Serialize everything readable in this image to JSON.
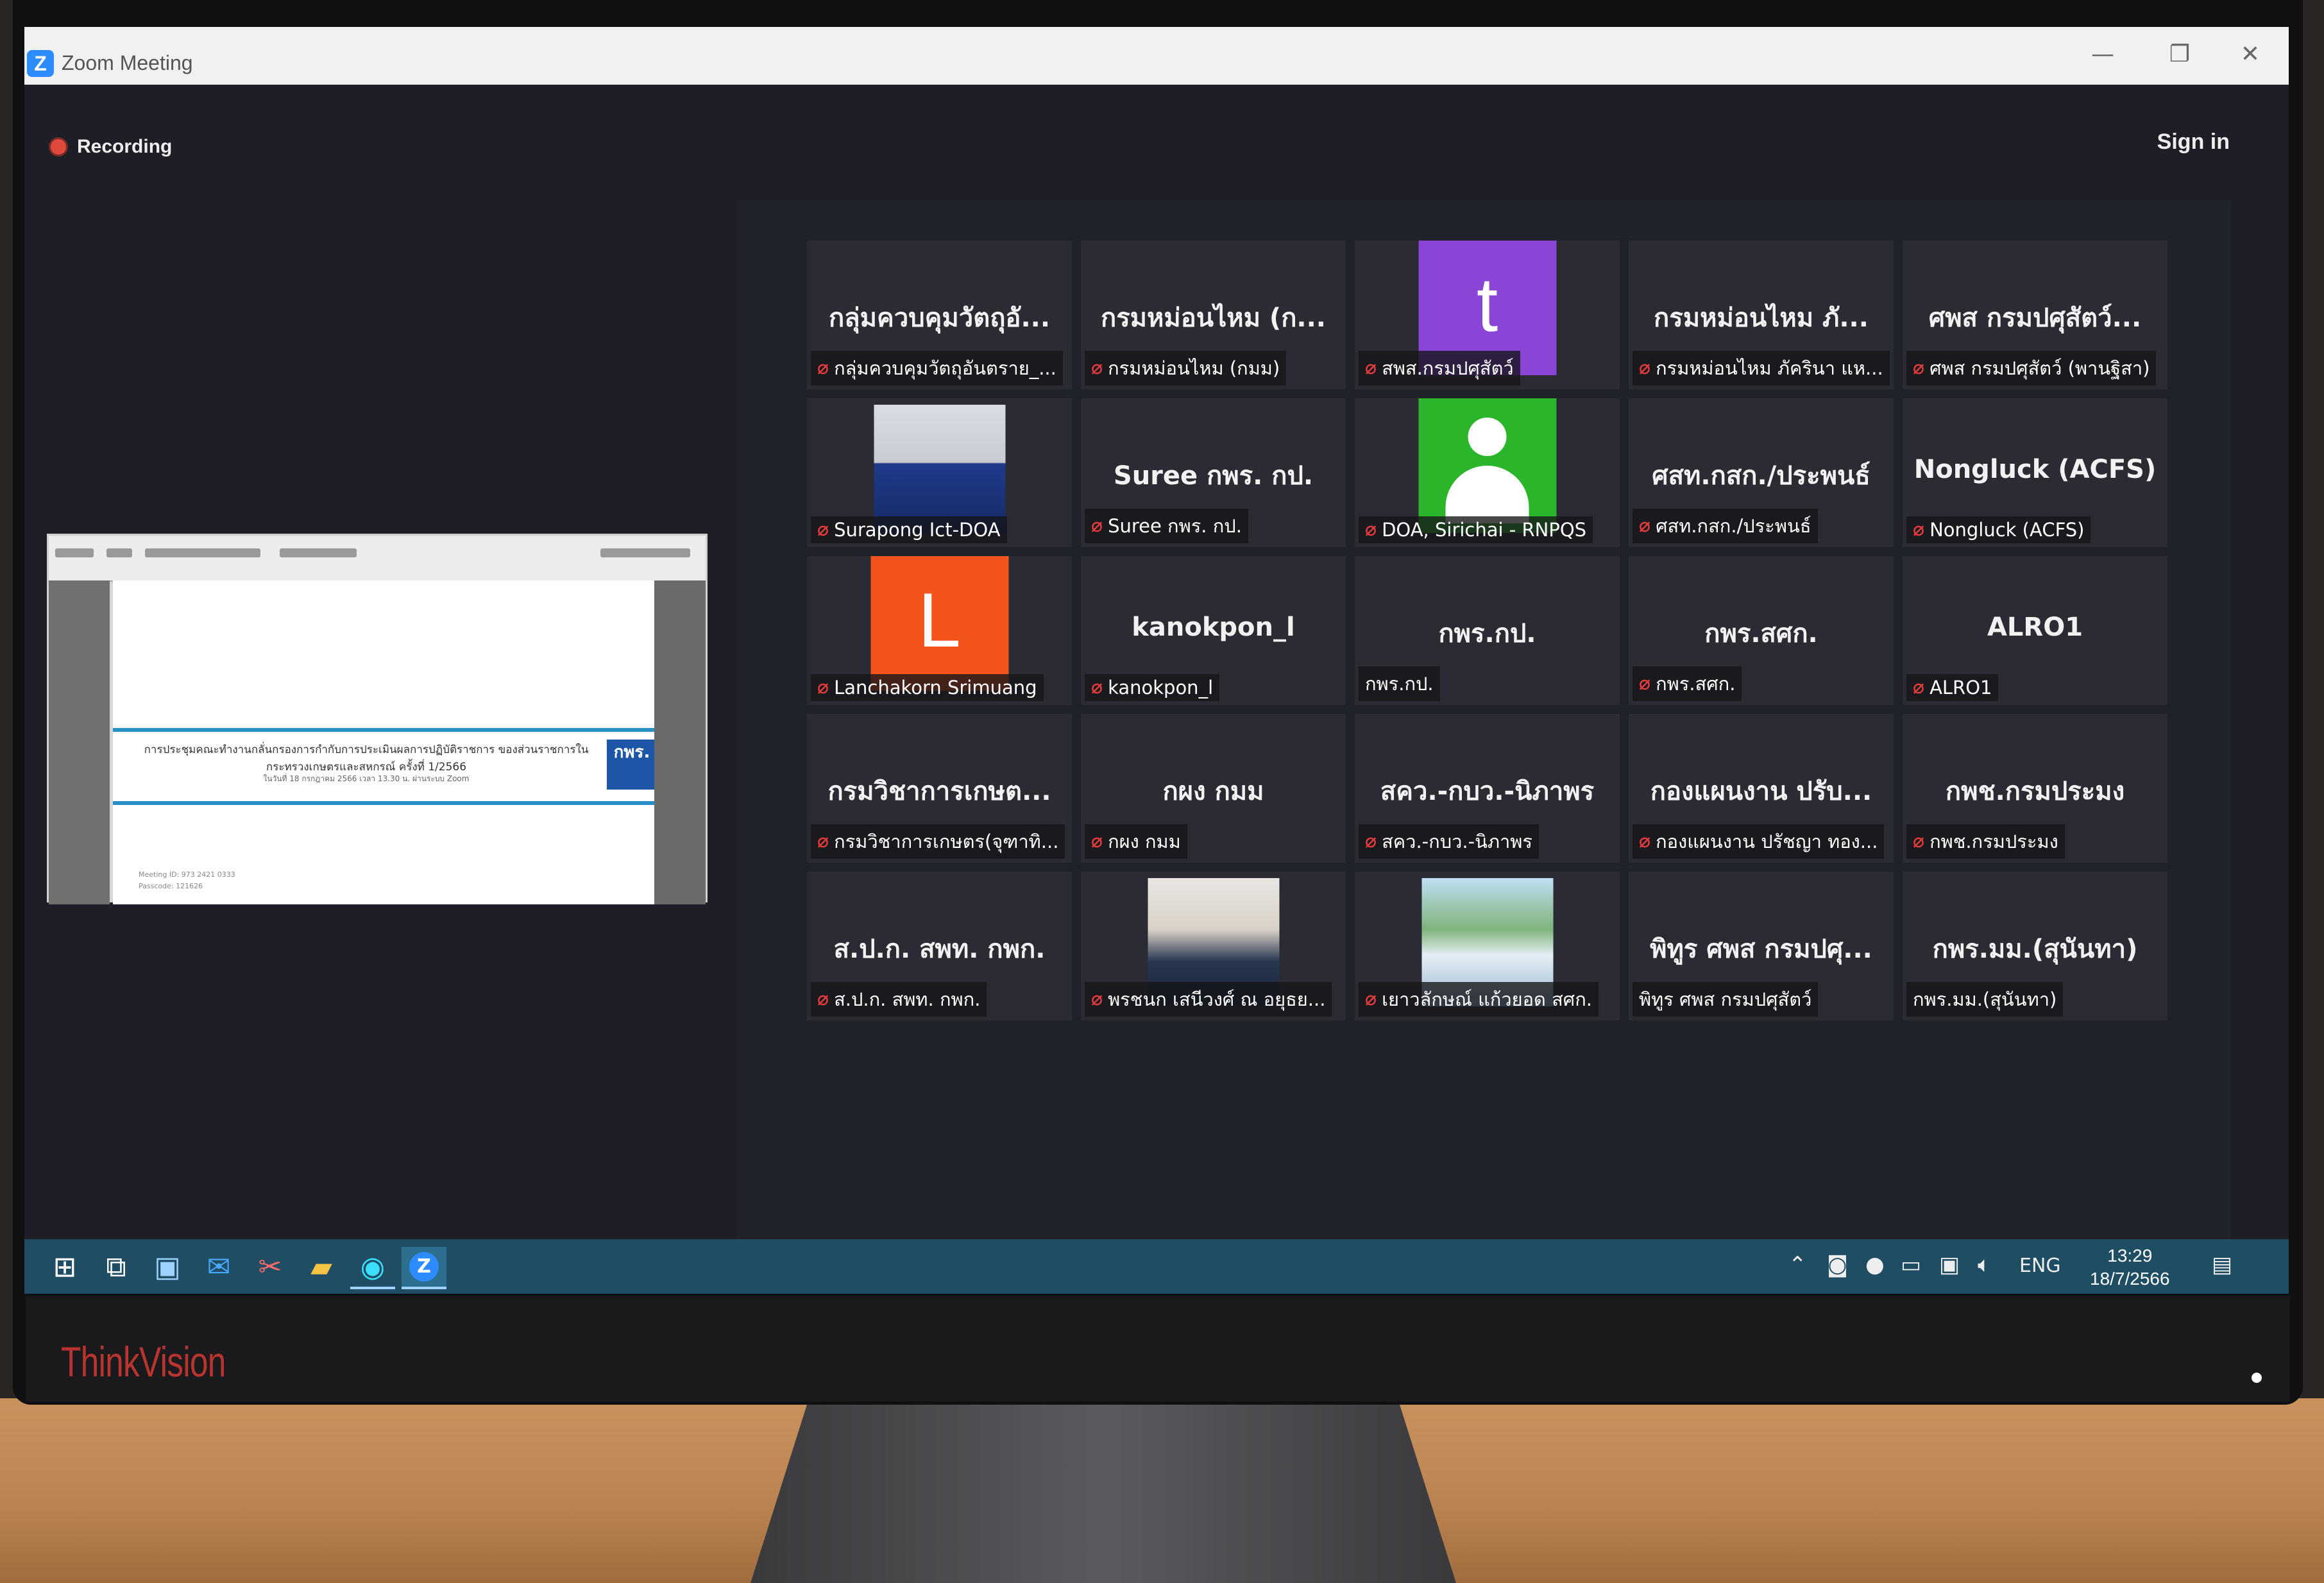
{
  "window": {
    "title": "Zoom Meeting",
    "minimize": "—",
    "restore": "❐",
    "close": "✕"
  },
  "meeting": {
    "recording_label": "Recording",
    "sign_in": "Sign in"
  },
  "shared_screen": {
    "title_line": "การประชุมคณะทำงานกลั่นกรองการกำกับการประเมินผลการปฏิบัติราชการ ของส่วนราชการในกระทรวงเกษตรและสหกรณ์ ครั้งที่ 1/2566",
    "subtitle_line": "ในวันที่ 18 กรกฎาคม 2566 เวลา 13.30 น. ผ่านระบบ Zoom",
    "badge": "กพร.",
    "meeting_info": [
      "Meeting ID: 973 2421 0333",
      "Passcode: 121626"
    ]
  },
  "participants": [
    {
      "tile_name": "กลุ่มควบคุมวัตถุอั...",
      "label": "กลุ่มควบคุมวัตถุอันตราย_...",
      "muted": true
    },
    {
      "tile_name": "กรมหม่อนไหม (ก...",
      "label": "กรมหม่อนไหม (กมม)",
      "muted": true
    },
    {
      "avatar_letter": "t",
      "avatar_color": "#8b45d6",
      "label": "สพส.กรมปศุสัตว์",
      "muted": true
    },
    {
      "tile_name": "กรมหม่อนไหม ภั...",
      "label": "กรมหม่อนไหม ภัครินา แห...",
      "muted": true
    },
    {
      "tile_name": "ศพส กรมปศุสัตว์...",
      "label": "ศพส กรมปศุสัตว์ (พานฐิสา)",
      "muted": true
    },
    {
      "photo": "man-mask",
      "label": "Surapong Ict-DOA",
      "muted": true
    },
    {
      "tile_name": "Suree กพร. กป.",
      "label": "Suree กพร. กป.",
      "muted": true
    },
    {
      "user_icon": true,
      "avatar_color": "#2bb52b",
      "label": "DOA, Sirichai - RNPQS",
      "muted": true
    },
    {
      "tile_name": "ศสท.กสก./ประพนธ์",
      "label": "ศสท.กสก./ประพนธ์",
      "muted": true
    },
    {
      "tile_name": "Nongluck (ACFS)",
      "label": "Nongluck (ACFS)",
      "muted": true
    },
    {
      "avatar_letter": "L",
      "avatar_color": "#f2541b",
      "label": "Lanchakorn Srimuang",
      "muted": true
    },
    {
      "tile_name": "kanokpon_l",
      "label": "kanokpon_l",
      "muted": true
    },
    {
      "tile_name": "กพร.กป.",
      "label": "กพร.กป.",
      "muted": false
    },
    {
      "tile_name": "กพร.สศก.",
      "label": "กพร.สศก.",
      "muted": true
    },
    {
      "tile_name": "ALRO1",
      "label": "ALRO1",
      "muted": true
    },
    {
      "tile_name": "กรมวิชาการเกษต...",
      "label": "กรมวิชาการเกษตร(จุฑาทิ...",
      "muted": true
    },
    {
      "tile_name": "กผง กมม",
      "label": "กผง กมม",
      "muted": true
    },
    {
      "tile_name": "สคว.-กบว.-นิภาพร",
      "label": "สคว.-กบว.-นิภาพร",
      "muted": true
    },
    {
      "tile_name": "กองแผนงาน ปรับ...",
      "label": "กองแผนงาน ปรัชญา ทอง...",
      "muted": true
    },
    {
      "tile_name": "กพช.กรมประมง",
      "label": "กพช.กรมประมง",
      "muted": true
    },
    {
      "tile_name": "ส.ป.ก. สพท. กพก.",
      "label": "ส.ป.ก. สพท. กพก.",
      "muted": true
    },
    {
      "photo": "woman-mask",
      "label": "พรชนก เสนีวงศ์ ณ อยุธย...",
      "muted": true
    },
    {
      "photo": "group-outdoor",
      "label": "เยาวลักษณ์ แก้วยอด สศก.",
      "muted": true
    },
    {
      "tile_name": "พิทูร ศพส กรมปศุ...",
      "label": "พิทูร ศพส กรมปศุสัตว์",
      "muted": false
    },
    {
      "tile_name": "กพร.มม.(สุนันทา)",
      "label": "กพร.มม.(สุนันทา)",
      "muted": false
    }
  ],
  "taskbar": {
    "language": "ENG",
    "time": "13:29",
    "date": "18/7/2566"
  },
  "monitor": {
    "brand": "ThinkVision"
  }
}
